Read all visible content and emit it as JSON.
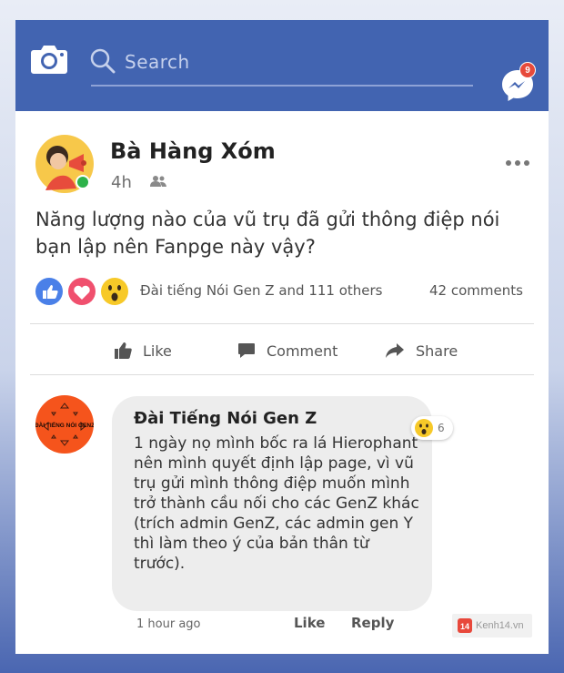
{
  "header": {
    "search_placeholder": "Search",
    "messenger_badge": "9",
    "colors": {
      "bar": "#4264b1",
      "badge": "#e74a3b"
    }
  },
  "post": {
    "author": "Bà Hàng Xóm",
    "time": "4h",
    "audience_icon": "friends-icon",
    "text": "Năng lượng nào của vũ trụ đã gửi thông điệp nói bạn lập nên Fanpge này vậy?",
    "reactions_summary": "Đài tiếng Nói Gen Z and 111 others",
    "comments_count": "42 comments",
    "reaction_icons": [
      "like-icon",
      "love-icon",
      "wow-icon"
    ]
  },
  "actions": {
    "like": "Like",
    "comment": "Comment",
    "share": "Share"
  },
  "comment": {
    "author": "Đài Tiếng Nói Gen Z",
    "avatar_text": "ĐÀI TIẾNG NÓI GENZ",
    "text": "1 ngày nọ mình bốc ra lá Hierophant nên mình quyết định lập page, vì vũ trụ gửi mình thông điệp muốn mình trở thành cầu nối cho các GenZ khác (trích admin GenZ, các admin gen Y thì làm theo ý của bản thân từ trước).",
    "reaction_count": "6",
    "time": "1 hour ago",
    "like": "Like",
    "reply": "Reply"
  },
  "watermark": {
    "logo": "14",
    "text": "Kenh14.vn"
  }
}
